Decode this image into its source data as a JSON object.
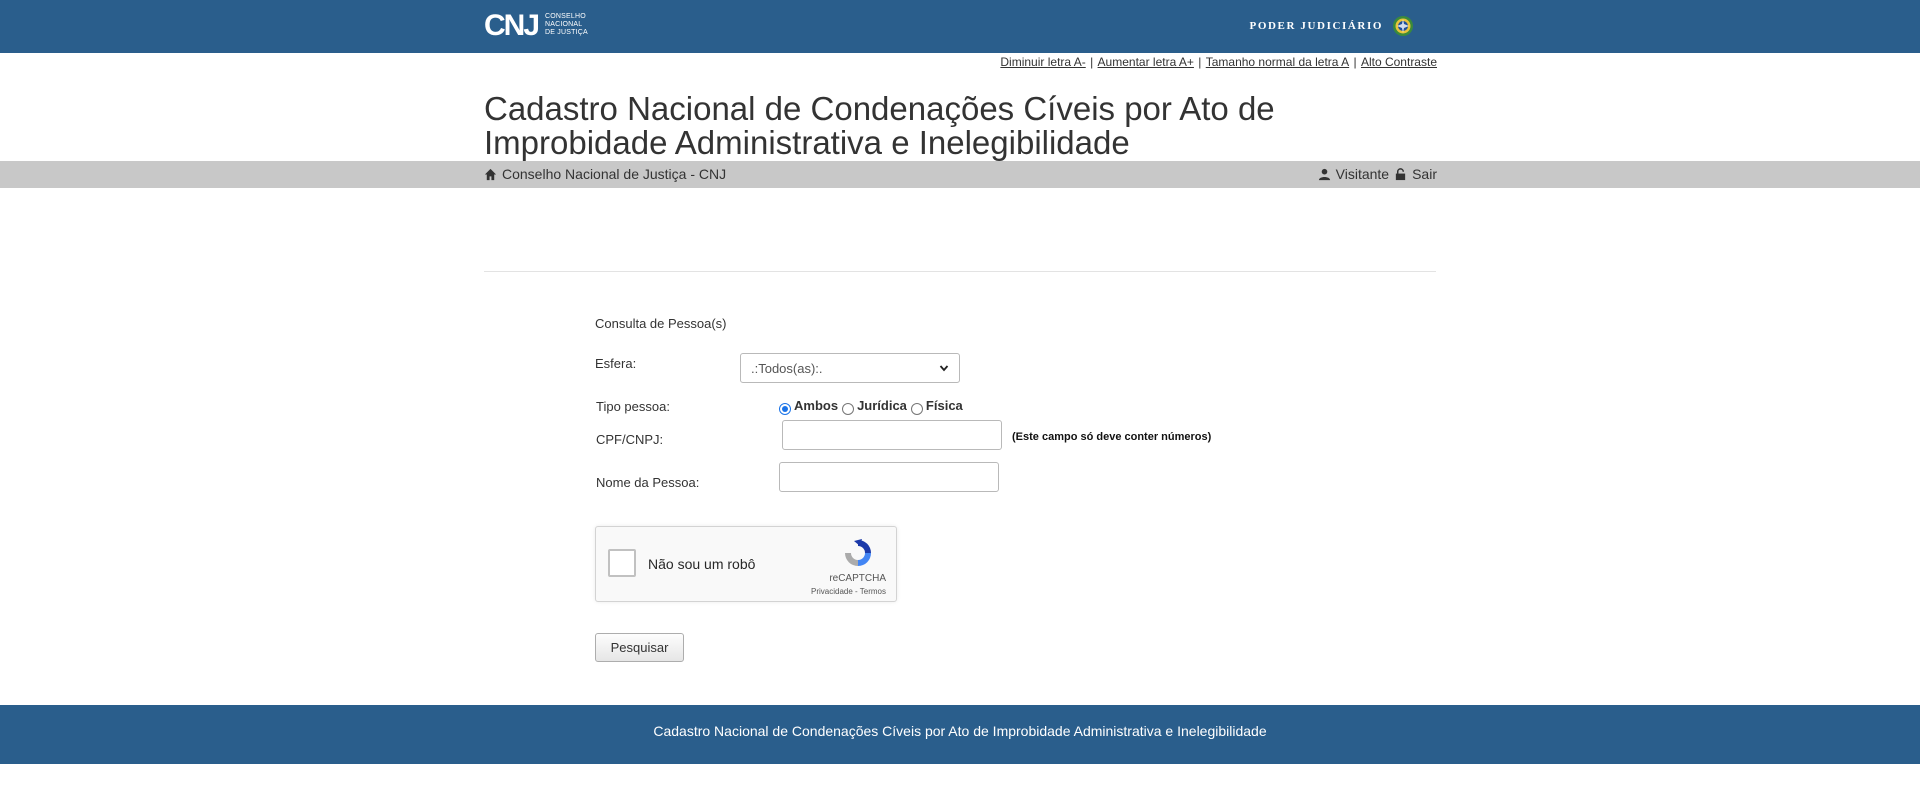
{
  "header": {
    "logo_text": "CNJ",
    "logo_subtitle": [
      "CONSELHO",
      "NACIONAL",
      "DE JUSTIÇA"
    ],
    "poder_judiciario": "PODER JUDICIÁRIO",
    "seal_icon": "brazil-coat-of-arms-icon",
    "background_color": "#2a5e8c"
  },
  "accessibility": {
    "decrease_font": "Diminuir letra A-",
    "increase_font": "Aumentar letra A+",
    "normal_font": "Tamanho normal da letra A",
    "high_contrast": "Alto Contraste"
  },
  "page_title": {
    "line1": "Cadastro Nacional de Condenações Cíveis por Ato de",
    "line2": "Improbidade Administrativa e Inelegibilidade"
  },
  "breadcrumb": {
    "home_icon": "home-icon",
    "label": "Conselho Nacional de Justiça - CNJ"
  },
  "user": {
    "user_icon": "user-icon",
    "name": "Visitante",
    "logout_icon": "lock-icon",
    "logout_label": "Sair"
  },
  "form": {
    "title": "Consulta de Pessoa(s)",
    "esfera_label": "Esfera:",
    "esfera_value": ".:Todos(as):.",
    "tipo_label": "Tipo pessoa:",
    "tipo_options": [
      {
        "label": "Ambos",
        "selected": true
      },
      {
        "label": "Jurídica",
        "selected": false
      },
      {
        "label": "Física",
        "selected": false
      }
    ],
    "cpf_label": "CPF/CNPJ:",
    "cpf_value": "",
    "cpf_hint": "(Este campo só deve conter números)",
    "nome_label": "Nome da Pessoa:",
    "nome_value": "",
    "submit_label": "Pesquisar"
  },
  "recaptcha": {
    "checkbox_label": "Não sou um robô",
    "brand": "reCAPTCHA",
    "privacy": "Privacidade",
    "terms": "Termos",
    "separator": " - "
  },
  "footer": {
    "text": "Cadastro Nacional de Condenações Cíveis por Ato de Improbidade Administrativa e Inelegibilidade"
  }
}
